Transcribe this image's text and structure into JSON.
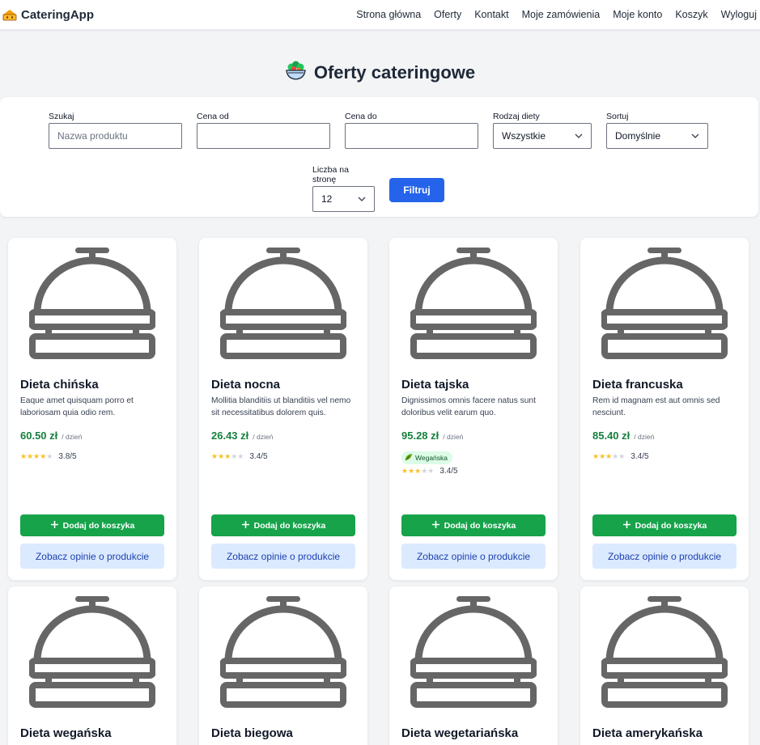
{
  "navbar": {
    "brand": "CateringApp",
    "links": [
      "Strona główna",
      "Oferty",
      "Kontakt",
      "Moje zamówienia",
      "Moje konto",
      "Koszyk",
      "Wyloguj"
    ]
  },
  "page": {
    "title": "Oferty cateringowe"
  },
  "filters": {
    "search": {
      "label": "Szukaj",
      "placeholder": "Nazwa produktu",
      "value": ""
    },
    "price_from": {
      "label": "Cena od",
      "value": ""
    },
    "price_to": {
      "label": "Cena do",
      "value": ""
    },
    "diet_type": {
      "label": "Rodzaj diety",
      "value": "Wszystkie"
    },
    "sort": {
      "label": "Sortuj",
      "value": "Domyślnie"
    },
    "per_page": {
      "label": "Liczba na stronę",
      "value": "12"
    },
    "submit_label": "Filtruj"
  },
  "products": [
    {
      "title": "Dieta chińska",
      "description": "Eaque amet quisquam porro et laboriosam quia odio rem.",
      "price": "60.50 zł",
      "unit": "/ dzień",
      "badge": "",
      "rating": 3.8,
      "rating_text": "3.8/5",
      "add_label": "Dodaj do koszyka",
      "reviews_label": "Zobacz opinie o produkcie"
    },
    {
      "title": "Dieta nocna",
      "description": "Mollitia blanditiis ut blanditiis vel nemo sit necessitatibus dolorem quis.",
      "price": "26.43 zł",
      "unit": "/ dzień",
      "badge": "",
      "rating": 3.4,
      "rating_text": "3.4/5",
      "add_label": "Dodaj do koszyka",
      "reviews_label": "Zobacz opinie o produkcie"
    },
    {
      "title": "Dieta tajska",
      "description": "Dignissimos omnis facere natus sunt doloribus velit earum quo.",
      "price": "95.28 zł",
      "unit": "/ dzień",
      "badge": "Wegańska",
      "rating": 3.4,
      "rating_text": "3.4/5",
      "add_label": "Dodaj do koszyka",
      "reviews_label": "Zobacz opinie o produkcie"
    },
    {
      "title": "Dieta francuska",
      "description": "Rem id magnam est aut omnis sed nesciunt.",
      "price": "85.40 zł",
      "unit": "/ dzień",
      "badge": "",
      "rating": 3.4,
      "rating_text": "3.4/5",
      "add_label": "Dodaj do koszyka",
      "reviews_label": "Zobacz opinie o produkcie"
    },
    {
      "title": "Dieta wegańska"
    },
    {
      "title": "Dieta biegowa"
    },
    {
      "title": "Dieta wegetariańska"
    },
    {
      "title": "Dieta amerykańska"
    }
  ],
  "colors": {
    "primary": "#2563eb",
    "add_button": "#16a34a",
    "price": "#15803d",
    "reviews_button_bg": "#dbeafe",
    "star": "#fbbf24"
  },
  "icons": {
    "brand": "food-cart-icon",
    "title": "salad-bowl-icon",
    "product": "service-bell-icon",
    "add": "plus-icon",
    "badge": "leaf-icon",
    "select": "chevron-down-icon"
  }
}
